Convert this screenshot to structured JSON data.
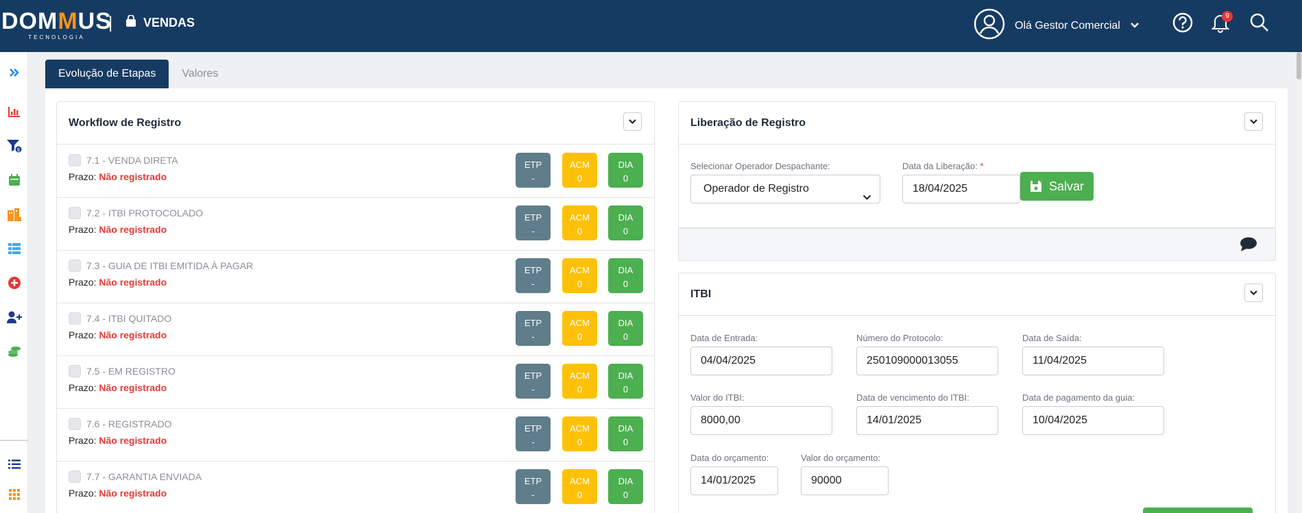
{
  "header": {
    "logo_main_a": "DOM",
    "logo_main_b": "M",
    "logo_main_c": "US",
    "logo_sub": "TECNOLOGIA",
    "separator": "|",
    "module_label": "VENDAS",
    "user_greeting": "Olá Gestor Comercial",
    "notifications_count": "9",
    "colors": {
      "primary": "#163b63",
      "accent": "#f7941d"
    }
  },
  "sidebar": {
    "items": [
      {
        "icon": "double-chevron-right-icon",
        "color": "#1e88e5"
      },
      {
        "icon": "bar-chart-icon",
        "color": "#e53935"
      },
      {
        "icon": "funnel-dollar-icon",
        "color": "#1e3a8a"
      },
      {
        "icon": "calendar-icon",
        "color": "#4caf50"
      },
      {
        "icon": "building-icon",
        "color": "#f7941d"
      },
      {
        "icon": "table-list-icon",
        "color": "#42a5f5"
      },
      {
        "icon": "plus-circle-icon",
        "color": "#e53935"
      },
      {
        "icon": "user-plus-icon",
        "color": "#1e3a8a"
      },
      {
        "icon": "coins-icon",
        "color": "#4caf50"
      },
      {
        "icon": "list-icon",
        "color": "#1e3a8a"
      },
      {
        "icon": "grid-icon",
        "color": "#f7941d"
      }
    ]
  },
  "tabs": [
    {
      "label": "Evolução de Etapas",
      "active": true
    },
    {
      "label": "Valores",
      "active": false
    }
  ],
  "workflow": {
    "title": "Workflow de Registro",
    "prazo_label": "Prazo:",
    "rows": [
      {
        "label": "7.1 - VENDA DIRETA",
        "prazo": "Não registrado",
        "etp": "ETP",
        "etp_val": "-",
        "acm": "ACM",
        "acm_val": "0",
        "dia": "DIA",
        "dia_val": "0"
      },
      {
        "label": "7.2 - ITBI PROTOCOLADO",
        "prazo": "Não registrado",
        "etp": "ETP",
        "etp_val": "-",
        "acm": "ACM",
        "acm_val": "0",
        "dia": "DIA",
        "dia_val": "0"
      },
      {
        "label": "7.3 - GUIA DE ITBI EMITIDA À PAGAR",
        "prazo": "Não registrado",
        "etp": "ETP",
        "etp_val": "-",
        "acm": "ACM",
        "acm_val": "0",
        "dia": "DIA",
        "dia_val": "0"
      },
      {
        "label": "7.4 - ITBI QUITADO",
        "prazo": "Não registrado",
        "etp": "ETP",
        "etp_val": "-",
        "acm": "ACM",
        "acm_val": "0",
        "dia": "DIA",
        "dia_val": "0"
      },
      {
        "label": "7.5 - EM REGISTRO",
        "prazo": "Não registrado",
        "etp": "ETP",
        "etp_val": "-",
        "acm": "ACM",
        "acm_val": "0",
        "dia": "DIA",
        "dia_val": "0"
      },
      {
        "label": "7.6 - REGISTRADO",
        "prazo": "Não registrado",
        "etp": "ETP",
        "etp_val": "-",
        "acm": "ACM",
        "acm_val": "0",
        "dia": "DIA",
        "dia_val": "0"
      },
      {
        "label": "7.7 - GARANTIA ENVIADA",
        "prazo": "Não registrado",
        "etp": "ETP",
        "etp_val": "-",
        "acm": "ACM",
        "acm_val": "0",
        "dia": "DIA",
        "dia_val": "0"
      }
    ]
  },
  "liberacao": {
    "title": "Liberação de Registro",
    "operator_label": "Selecionar Operador Despachante:",
    "operator_value": "Operador de Registro",
    "date_label": "Data da Liberação:",
    "required_mark": "*",
    "date_value": "18/04/2025",
    "save_label": "Salvar"
  },
  "itbi": {
    "title": "ITBI",
    "data_entrada_label": "Data de Entrada:",
    "data_entrada": "04/04/2025",
    "protocolo_label": "Número do Protocolo:",
    "protocolo": "250109000013055",
    "data_saida_label": "Data de Saída:",
    "data_saida": "11/04/2025",
    "valor_itbi_label": "Valor do ITBI:",
    "valor_itbi": "8000,00",
    "venc_label": "Data de vencimento do ITBI:",
    "venc": "14/01/2025",
    "pag_label": "Data de pagamento da guia:",
    "pag": "10/04/2025",
    "orc_data_label": "Data do orçamento:",
    "orc_data": "14/01/2025",
    "orc_valor_label": "Valor do orçamento:",
    "orc_valor": "90000"
  }
}
